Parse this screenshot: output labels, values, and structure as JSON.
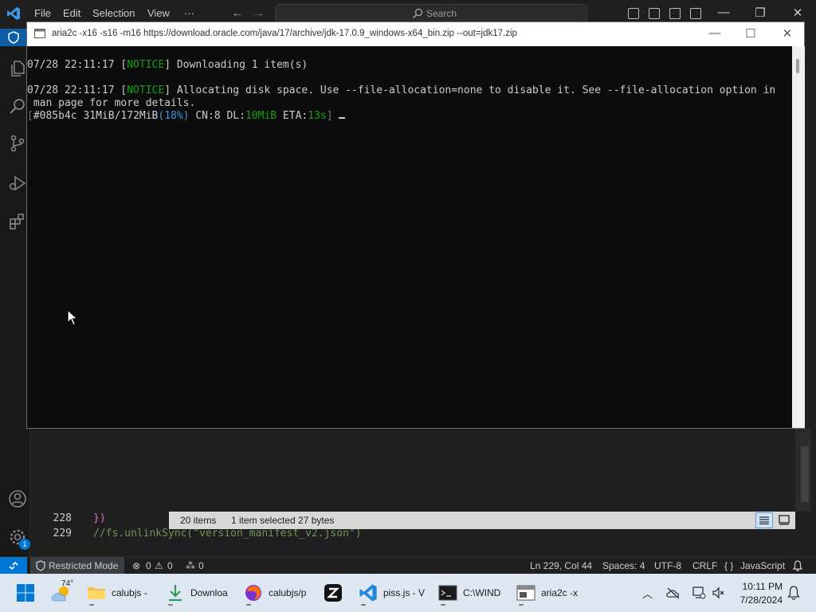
{
  "vscode": {
    "menu": [
      "File",
      "Edit",
      "Selection",
      "View",
      "···"
    ],
    "search_placeholder": "Search",
    "window_controls": {
      "minimize": "—",
      "restore": "❐",
      "close": "✕"
    },
    "editor": {
      "lines": [
        {
          "num": "228",
          "code": "})"
        },
        {
          "num": "229",
          "code": "//fs.unlinkSync(\"version_manifest_v2.json\")"
        }
      ]
    },
    "statusbar": {
      "restricted": "Restricted Mode",
      "errors": "0",
      "warnings": "0",
      "ports": "0",
      "position": "Ln 229, Col 44",
      "spaces": "Spaces: 4",
      "encoding": "UTF-8",
      "eol": "CRLF",
      "language_braces": "{ }",
      "language": "JavaScript"
    },
    "accounts_badge": "1"
  },
  "explorer_strip": {
    "items": "20 items",
    "selected": "1 item selected  27 bytes"
  },
  "terminal": {
    "title": "aria2c  -x16 -s16 -m16 https://download.oracle.com/java/17/archive/jdk-17.0.9_windows-x64_bin.zip --out=jdk17.zip",
    "controls": {
      "minimize": "—",
      "maximize": "☐",
      "close": "✕"
    },
    "line1": {
      "time": "07/28 22:11:17 [",
      "tag": "NOTICE",
      "msg": "] Downloading 1 item(s)"
    },
    "line2": {
      "time": "07/28 22:11:17 [",
      "tag": "NOTICE",
      "msg": "] Allocating disk space. Use --file-allocation=none to disable it. See --file-allocation option in"
    },
    "line3": " man page for more details.",
    "progress": {
      "open": "[",
      "gid": "#085b4c",
      "size": " 31MiB/172MiB",
      "pct": "(18%)",
      "cn": " CN:8",
      "dl_label": " DL:",
      "dl_value": "10MiB",
      "eta_label": " ETA:",
      "eta_value": "13s",
      "close": "]"
    }
  },
  "taskbar": {
    "weather_temp": "74°",
    "apps": [
      {
        "label": "calubjs -",
        "icon": "folder-icon"
      },
      {
        "label": "Downloa",
        "icon": "download-icon"
      },
      {
        "label": "calubjs/p",
        "icon": "firefox-icon"
      },
      {
        "label": "",
        "icon": "zed-icon"
      },
      {
        "label": "piss.js - V",
        "icon": "vscode-icon"
      },
      {
        "label": "C:\\WIND",
        "icon": "cmd-icon"
      },
      {
        "label": "aria2c  -x",
        "icon": "terminal-icon"
      }
    ],
    "clock_time": "10:11 PM",
    "clock_date": "7/28/2024"
  },
  "colors": {
    "notice": "#13a10e",
    "pct": "#3a96dd",
    "accent": "#0078d4"
  }
}
